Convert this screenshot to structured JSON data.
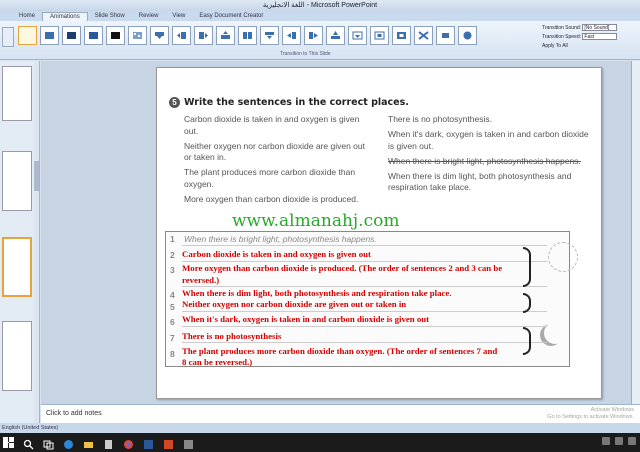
{
  "window": {
    "title": "اللغة الانجليزية - Microsoft PowerPoint"
  },
  "ribbon": {
    "tabs": [
      "Home",
      "Animations",
      "Slide Show",
      "Review",
      "View",
      "Easy Document Creator"
    ],
    "active_tab": "Animations",
    "group_label": "Transition to This Slide",
    "transition_sound_label": "Transition Sound:",
    "transition_sound_value": "[No Sound]",
    "transition_speed_label": "Transition Speed:",
    "transition_speed_value": "Fast",
    "apply_all_label": "Apply To All"
  },
  "slide": {
    "question_number": "5",
    "question_title": "Write the sentences in the correct places.",
    "left_column": [
      "Carbon dioxide is taken in and oxygen is given out.",
      "Neither oxygen nor carbon dioxide are given out or taken in.",
      "The plant produces more carbon dioxide than oxygen.",
      "More oxygen than carbon dioxide is produced."
    ],
    "right_column": [
      "There is no photosynthesis.",
      "When it's dark, oxygen is taken in and carbon dioxide is given out.",
      "When there is bright light, photosynthesis happens.",
      "When there is dim light, both photosynthesis and respiration take place."
    ],
    "watermark": "www.almanahj.com",
    "answers": [
      {
        "num": "1",
        "text": "When there is bright light, photosynthesis happens."
      },
      {
        "num": "2",
        "text": "Carbon dioxide is taken in and oxygen is given out"
      },
      {
        "num": "3",
        "text": "More oxygen than carbon dioxide is produced. (The order of sentences 2 and 3 can be"
      },
      {
        "num": "",
        "text": "reversed.)"
      },
      {
        "num": "4",
        "text": "When there is dim light, both photosynthesis and respiration take place."
      },
      {
        "num": "5",
        "text": "Neither oxygen nor carbon dioxide are given out or taken in"
      },
      {
        "num": "6",
        "text": "When it's dark, oxygen is taken in and carbon dioxide is given out"
      },
      {
        "num": "7",
        "text": "There is no photosynthesis"
      },
      {
        "num": "8",
        "text": "The plant produces more carbon dioxide than oxygen. (The order of sentences 7 and"
      },
      {
        "num": "",
        "text": "8 can be reversed.)"
      }
    ]
  },
  "notes": {
    "placeholder": "Click to add notes",
    "activate_line1": "Activate Windows",
    "activate_line2": "Go to Settings to activate Windows."
  },
  "status": {
    "language": "English (United States)"
  }
}
